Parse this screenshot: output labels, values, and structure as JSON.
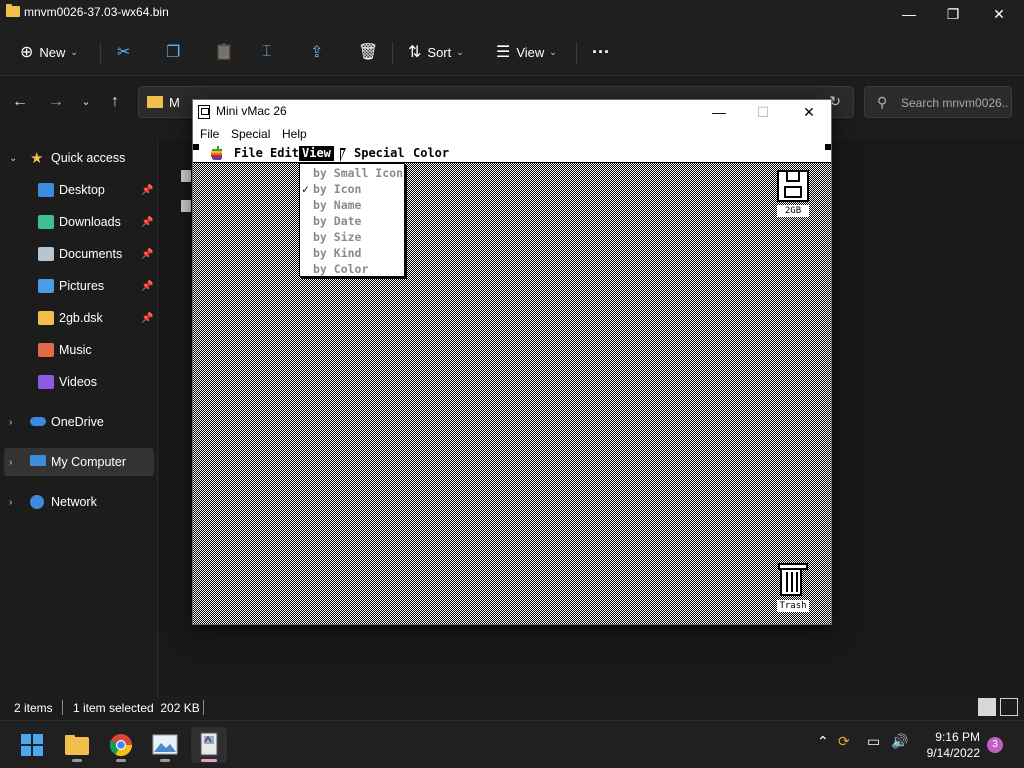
{
  "explorer": {
    "title": "mnvm0026-37.03-wx64.bin",
    "window_controls": {
      "minimize": "—",
      "maximize": "❐",
      "close": "✕"
    },
    "commands": {
      "new_label": "New",
      "sort_label": "Sort",
      "view_label": "View",
      "more_label": "···"
    },
    "address_crumb": "M",
    "search_placeholder": "Search mnvm0026...",
    "sidebar": {
      "quick_access": "Quick access",
      "items": [
        {
          "label": "Desktop",
          "icon": "desktop-icon",
          "color": "#3c8be0"
        },
        {
          "label": "Downloads",
          "icon": "download-icon",
          "color": "#3fbf8f"
        },
        {
          "label": "Documents",
          "icon": "document-icon",
          "color": "#b8c4d0"
        },
        {
          "label": "Pictures",
          "icon": "picture-icon",
          "color": "#4a9be8"
        },
        {
          "label": "2gb.dsk",
          "icon": "folder-icon",
          "color": "#f0c04a"
        },
        {
          "label": "Music",
          "icon": "music-icon",
          "color": "#e06a4a"
        },
        {
          "label": "Videos",
          "icon": "video-icon",
          "color": "#8a5ae0"
        }
      ],
      "onedrive": "OneDrive",
      "my_computer": "My Computer",
      "network": "Network"
    },
    "status": {
      "items": "2 items",
      "selection": "1 item selected  202 KB"
    }
  },
  "vmac": {
    "title": "Mini vMac 26",
    "window_controls": {
      "minimize": "—",
      "maximize": "☐",
      "close": "✕"
    },
    "menu": {
      "file": "File",
      "special": "Special",
      "help": "Help"
    },
    "mac_menubar": {
      "file": "File",
      "edit": "Edit",
      "view": "View",
      "special": "Special",
      "color": "Color"
    },
    "view_menu_items": [
      {
        "label": "by Small Icon",
        "checked": false
      },
      {
        "label": "by Icon",
        "checked": true
      },
      {
        "label": "by Name",
        "checked": false
      },
      {
        "label": "by Date",
        "checked": false
      },
      {
        "label": "by Size",
        "checked": false
      },
      {
        "label": "by Kind",
        "checked": false
      },
      {
        "label": "by Color",
        "checked": false
      }
    ],
    "check_mark": "✓",
    "disk_label": "2GB",
    "trash_label": "Trash"
  },
  "taskbar": {
    "time": "9:16 PM",
    "date": "9/14/2022",
    "notification_count": "3"
  }
}
